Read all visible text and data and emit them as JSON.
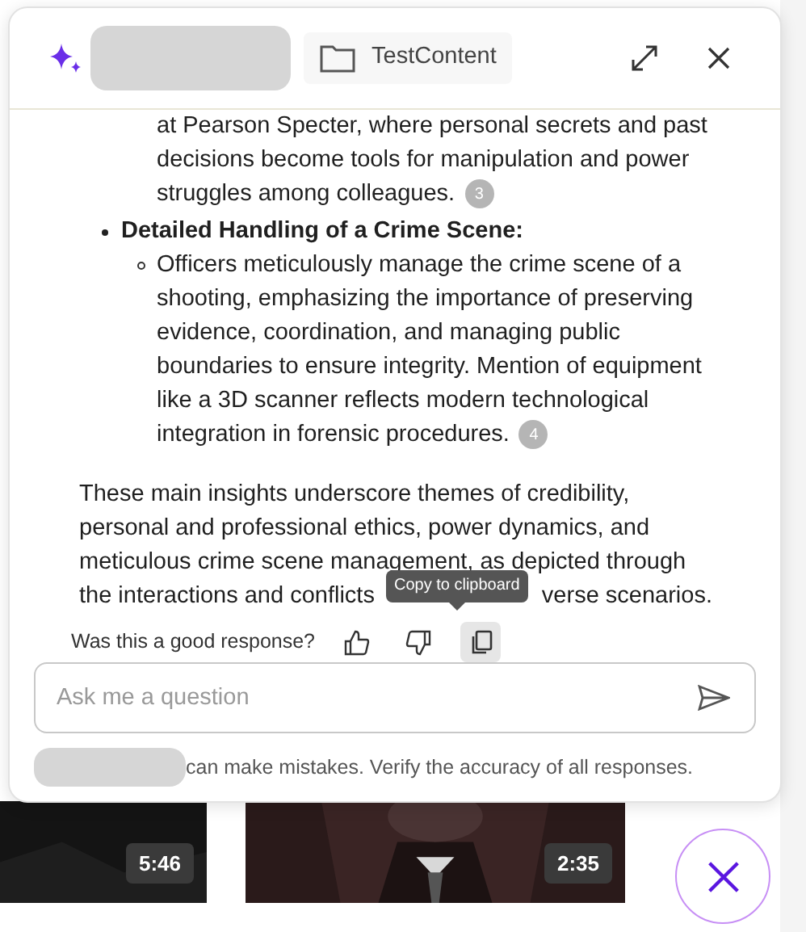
{
  "header": {
    "folder": "TestContent"
  },
  "answer": {
    "items": [
      {
        "subitems": [
          {
            "text": "at Pearson Specter, where personal secrets and past decisions become tools for manipulation and power struggles among colleagues.",
            "citation": "3"
          }
        ]
      },
      {
        "title": "Detailed Handling of a Crime Scene:",
        "subitems": [
          {
            "text": "Officers meticulously manage the crime scene of a shooting, emphasizing the importance of preserving evidence, coordination, and managing public boundaries to ensure integrity. Mention of equipment like a 3D scanner reflects modern technological integration in forensic procedures.",
            "citation": "4"
          }
        ]
      }
    ],
    "summary_lines": [
      "These main insights underscore themes of credibility,",
      "personal and professional ethics, power dynamics, and",
      "meticulous crime scene management, as depicted through",
      "the interactions and conflicts"
    ],
    "summary_tail": "verse scenarios."
  },
  "feedback": {
    "prompt": "Was this a good response?",
    "tooltip": "Copy to clipboard"
  },
  "input": {
    "placeholder": "Ask me a question"
  },
  "disclaimer": "can make mistakes. Verify the accuracy of all responses.",
  "videos": [
    {
      "duration": "5:46"
    },
    {
      "duration": "2:35"
    }
  ]
}
